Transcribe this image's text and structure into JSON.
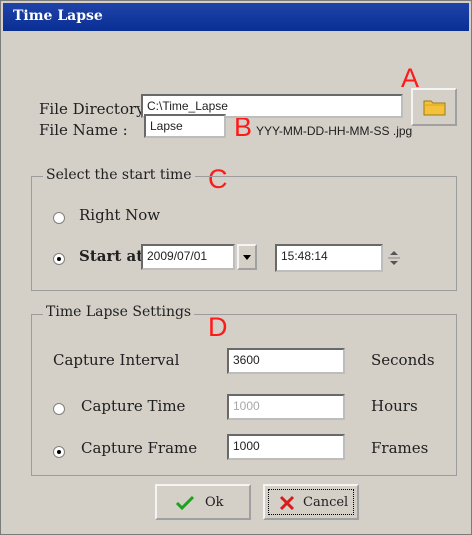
{
  "window": {
    "title": "Time Lapse"
  },
  "markers": {
    "a": "A",
    "b": "B",
    "c": "C",
    "d": "D"
  },
  "file_directory": {
    "label": "File Directory",
    "value": "C:\\Time_Lapse"
  },
  "file_name": {
    "label": "File Name :",
    "value": "Lapse",
    "suffix": "YYY-MM-DD-HH-MM-SS .jpg"
  },
  "start_time": {
    "legend": "Select the start time",
    "right_now": {
      "label": "Right Now",
      "selected": false
    },
    "start_at": {
      "label": "Start at",
      "selected": true,
      "date": "2009/07/01",
      "time": "15:48:14"
    }
  },
  "settings": {
    "legend": "Time Lapse Settings",
    "capture_interval": {
      "label": "Capture Interval",
      "value": "3600",
      "unit": "Seconds"
    },
    "capture_time": {
      "label": "Capture Time",
      "value": "1000",
      "unit": "Hours",
      "selected": false
    },
    "capture_frame": {
      "label": "Capture Frame",
      "value": "1000",
      "unit": "Frames",
      "selected": true
    }
  },
  "buttons": {
    "ok": "Ok",
    "cancel": "Cancel"
  },
  "colors": {
    "titlebar": "#0a2f94",
    "marker": "#ff1a1a",
    "ok_check": "#1aa31a",
    "cancel_x": "#d81c1c"
  },
  "icons": [
    "folder-icon",
    "chevron-down-icon",
    "spin-up-icon",
    "spin-down-icon",
    "check-icon",
    "x-icon"
  ]
}
